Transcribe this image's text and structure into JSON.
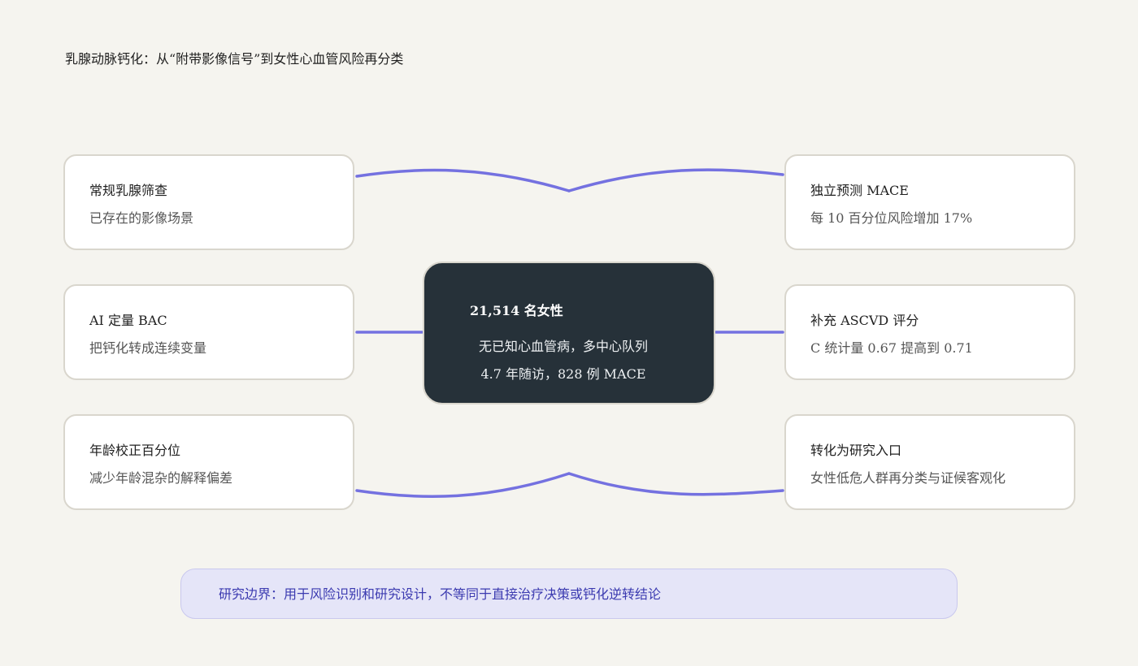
{
  "title": "乳腺动脉钙化：从“附带影像信号”到女性心血管风险再分类",
  "colors": {
    "background": "#f5f4ef",
    "connector": "#7471e0",
    "center_fill": "#263139",
    "card_fill": "#ffffff",
    "card_border": "#d9d6cd",
    "boundary_fill": "#e5e5f8",
    "boundary_text": "#3b3ab0"
  },
  "center": {
    "title": "21,514 名女性",
    "line1": "无已知心血管病，多中心队列",
    "line2": "4.7 年随访，828 例 MACE"
  },
  "left_nodes": [
    {
      "title": "常规乳腺筛查",
      "subtitle": "已存在的影像场景"
    },
    {
      "title": "AI 定量 BAC",
      "subtitle": "把钙化转成连续变量"
    },
    {
      "title": "年龄校正百分位",
      "subtitle": "减少年龄混杂的解释偏差"
    }
  ],
  "right_nodes": [
    {
      "title": "独立预测 MACE",
      "subtitle": "每 10 百分位风险增加 17%"
    },
    {
      "title": "补充 ASCVD 评分",
      "subtitle": "C 统计量 0.67 提高到 0.71"
    },
    {
      "title": "转化为研究入口",
      "subtitle": "女性低危人群再分类与证候客观化"
    }
  ],
  "boundary_note": "研究边界：用于风险识别和研究设计，不等同于直接治疗决策或钙化逆转结论"
}
